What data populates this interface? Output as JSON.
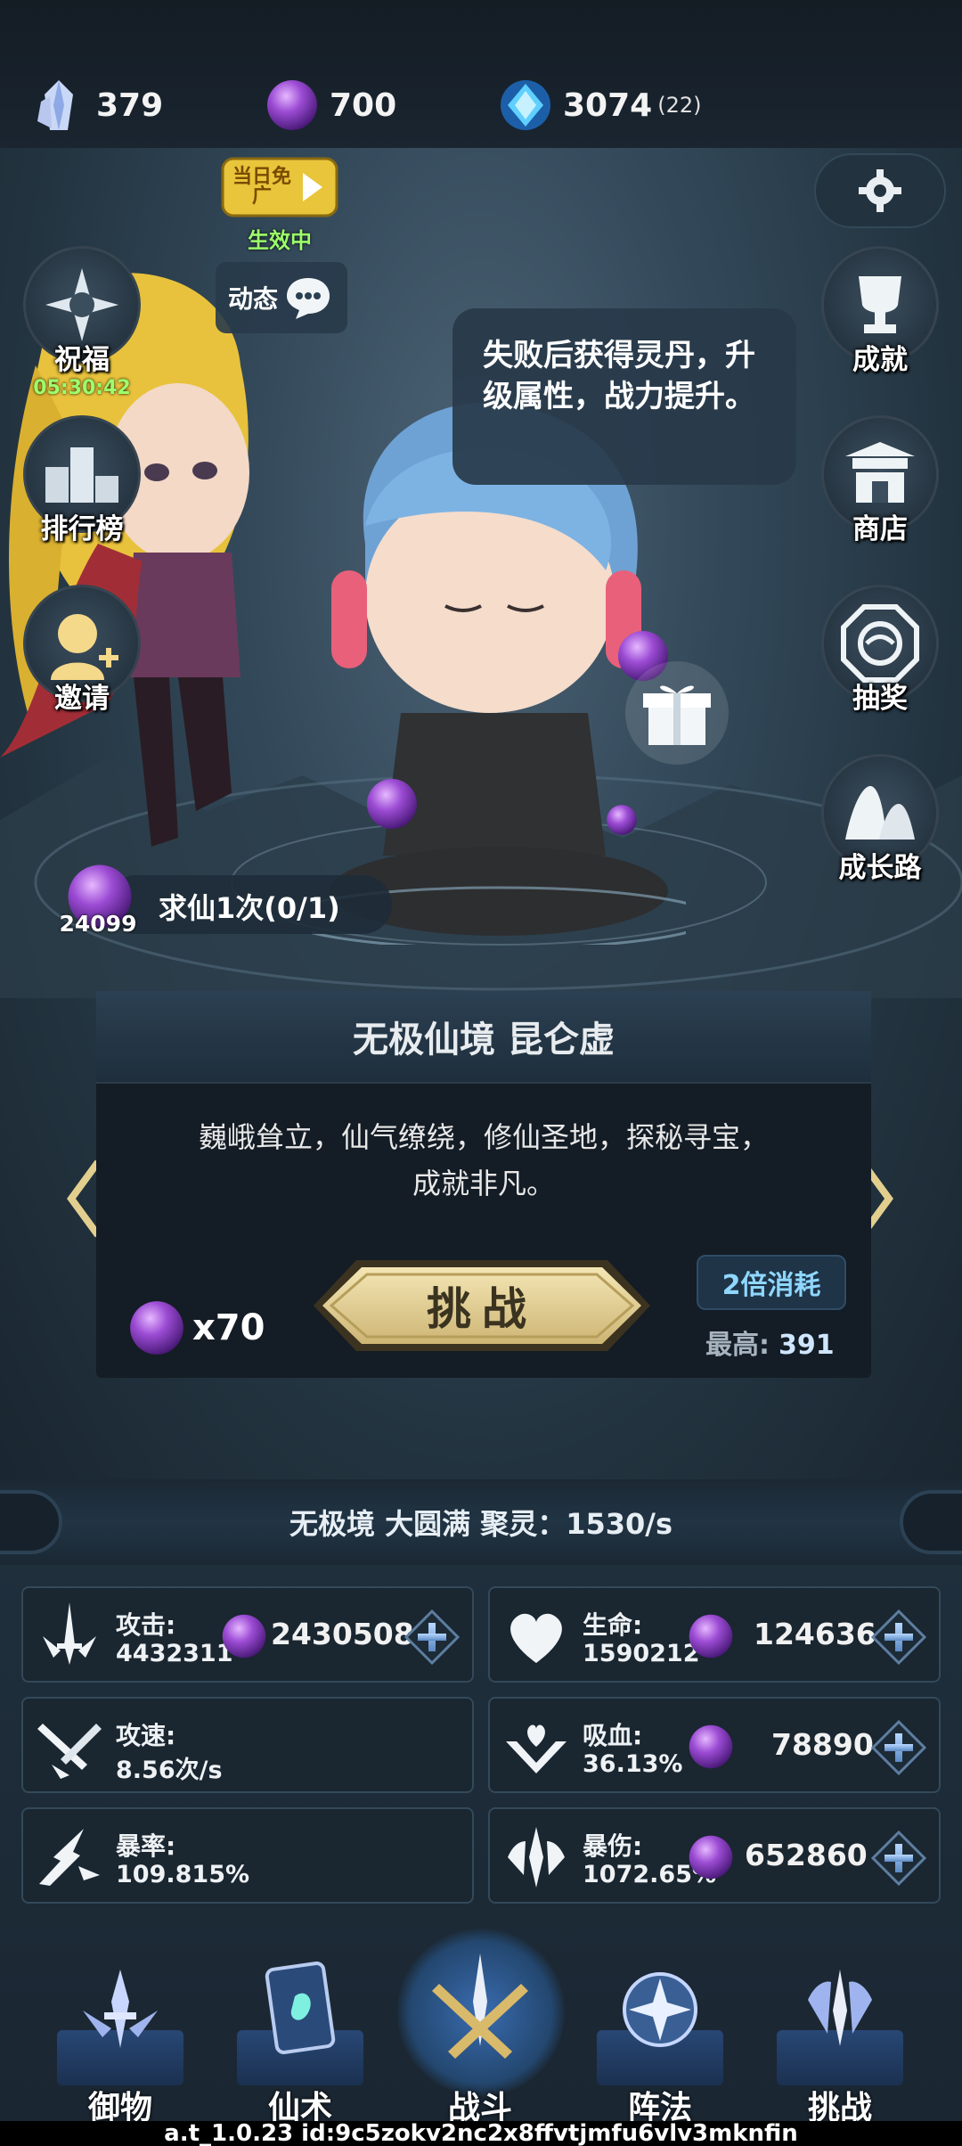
{
  "currencies": [
    {
      "icon": "crystal-icon",
      "value": "379",
      "sub": ""
    },
    {
      "icon": "purple-orb-icon",
      "value": "700",
      "sub": ""
    },
    {
      "icon": "blue-gem-icon",
      "value": "3074",
      "sub": "(22)"
    }
  ],
  "ad_badge": {
    "text": "当日免广",
    "status": "生效中"
  },
  "dynamic_label": "动态",
  "left_buttons": [
    {
      "label": "祝福",
      "timer": "05:30:42",
      "icon": "compass-star-icon"
    },
    {
      "label": "排行榜",
      "icon": "podium-icon"
    },
    {
      "label": "邀请",
      "icon": "invite-person-icon"
    }
  ],
  "right_buttons": [
    {
      "label": "成就",
      "icon": "trophy-icon"
    },
    {
      "label": "商店",
      "icon": "shop-icon"
    },
    {
      "label": "抽奖",
      "icon": "lottery-icon"
    },
    {
      "label": "成长路",
      "icon": "mountain-icon"
    }
  ],
  "bubble_text": "失败后获得灵丹，升级属性，战力提升。",
  "quest": {
    "count": "24099",
    "label": "求仙1次(0/1)"
  },
  "stage_card": {
    "title": "无极仙境 昆仑虚",
    "desc_line1": "巍峨耸立，仙气缭绕，修仙圣地，探秘寻宝，",
    "desc_line2": "成就非凡。",
    "cost": "x70",
    "challenge": "挑战",
    "double": "2倍消耗",
    "highest_label": "最高:",
    "highest_value": "391"
  },
  "realm_status": "无极境 大圆满 聚灵：1530/s",
  "stats": [
    {
      "name": "攻击:",
      "value": "4432311",
      "cost": "2430508",
      "icon": "sword-icon",
      "upgrade": true
    },
    {
      "name": "生命:",
      "value": "1590212",
      "cost": "124636",
      "icon": "heart-icon",
      "upgrade": true
    },
    {
      "name": "攻速:",
      "value": "8.56次/s",
      "cost": "",
      "icon": "attack-speed-icon",
      "upgrade": false
    },
    {
      "name": "吸血:",
      "value": "36.13%",
      "cost": "78890",
      "icon": "lifesteal-icon",
      "upgrade": true
    },
    {
      "name": "暴率:",
      "value": "109.815%",
      "cost": "",
      "icon": "crit-rate-icon",
      "upgrade": false
    },
    {
      "name": "暴伤:",
      "value": "1072.65%",
      "cost": "652860",
      "icon": "crit-damage-icon",
      "upgrade": true
    }
  ],
  "nav": [
    {
      "label": "御物",
      "icon": "artifact-icon"
    },
    {
      "label": "仙术",
      "icon": "spell-card-icon"
    },
    {
      "label": "战斗",
      "icon": "battle-icon"
    },
    {
      "label": "阵法",
      "icon": "formation-icon"
    },
    {
      "label": "挑战",
      "icon": "challenge-icon"
    }
  ],
  "version": "a.t_1.0.23 id:9c5zokv2nc2x8ffvtjmfu6vlv3mknfin",
  "colors": {
    "accent_gold": "#e9d9a2",
    "orb_purple": "#9c4cd4",
    "timer_green": "#9cff6a"
  }
}
